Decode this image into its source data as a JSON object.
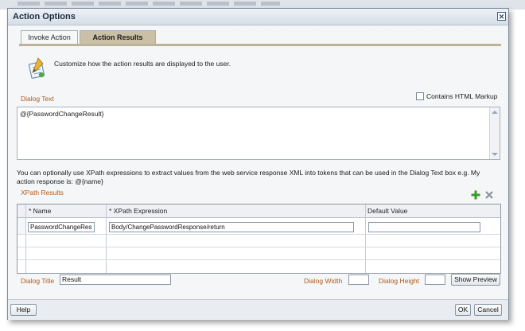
{
  "dialog": {
    "title": "Action Options",
    "close_icon": "close-icon"
  },
  "tabs": [
    {
      "label": "Invoke Action",
      "active": false
    },
    {
      "label": "Action Results",
      "active": true
    }
  ],
  "info": {
    "icon": "customize-results-icon",
    "text": "Customize how the action results are displayed to the user."
  },
  "dialog_text": {
    "label": "Dialog Text",
    "value": "@{PasswordChangeResult}",
    "html_markup_label": "Contains HTML Markup",
    "html_markup_checked": false
  },
  "help_text": "You can optionally use XPath expressions to extract values from the web service response XML into tokens that can be used in the Dialog Text box e.g. My action response is: @{name}",
  "xpath": {
    "label": "XPath Results",
    "add_icon": "add-icon",
    "delete_icon": "delete-icon",
    "columns": [
      "* Name",
      "* XPath Expression",
      "Default Value"
    ],
    "rows": [
      {
        "name": "PasswordChangeRes",
        "expression": "Body/ChangePasswordResponse/return",
        "default": ""
      }
    ]
  },
  "dialog_title": {
    "label": "Dialog Title",
    "value": "Result"
  },
  "dialog_width": {
    "label": "Dialog Width",
    "value": ""
  },
  "dialog_height": {
    "label": "Dialog Height",
    "value": ""
  },
  "buttons": {
    "show_preview": "Show Preview",
    "help": "Help",
    "ok": "OK",
    "cancel": "Cancel"
  },
  "colors": {
    "label_orange": "#b05b18",
    "active_tab": "#c9c0a6",
    "add_green": "#3a9b2e"
  }
}
